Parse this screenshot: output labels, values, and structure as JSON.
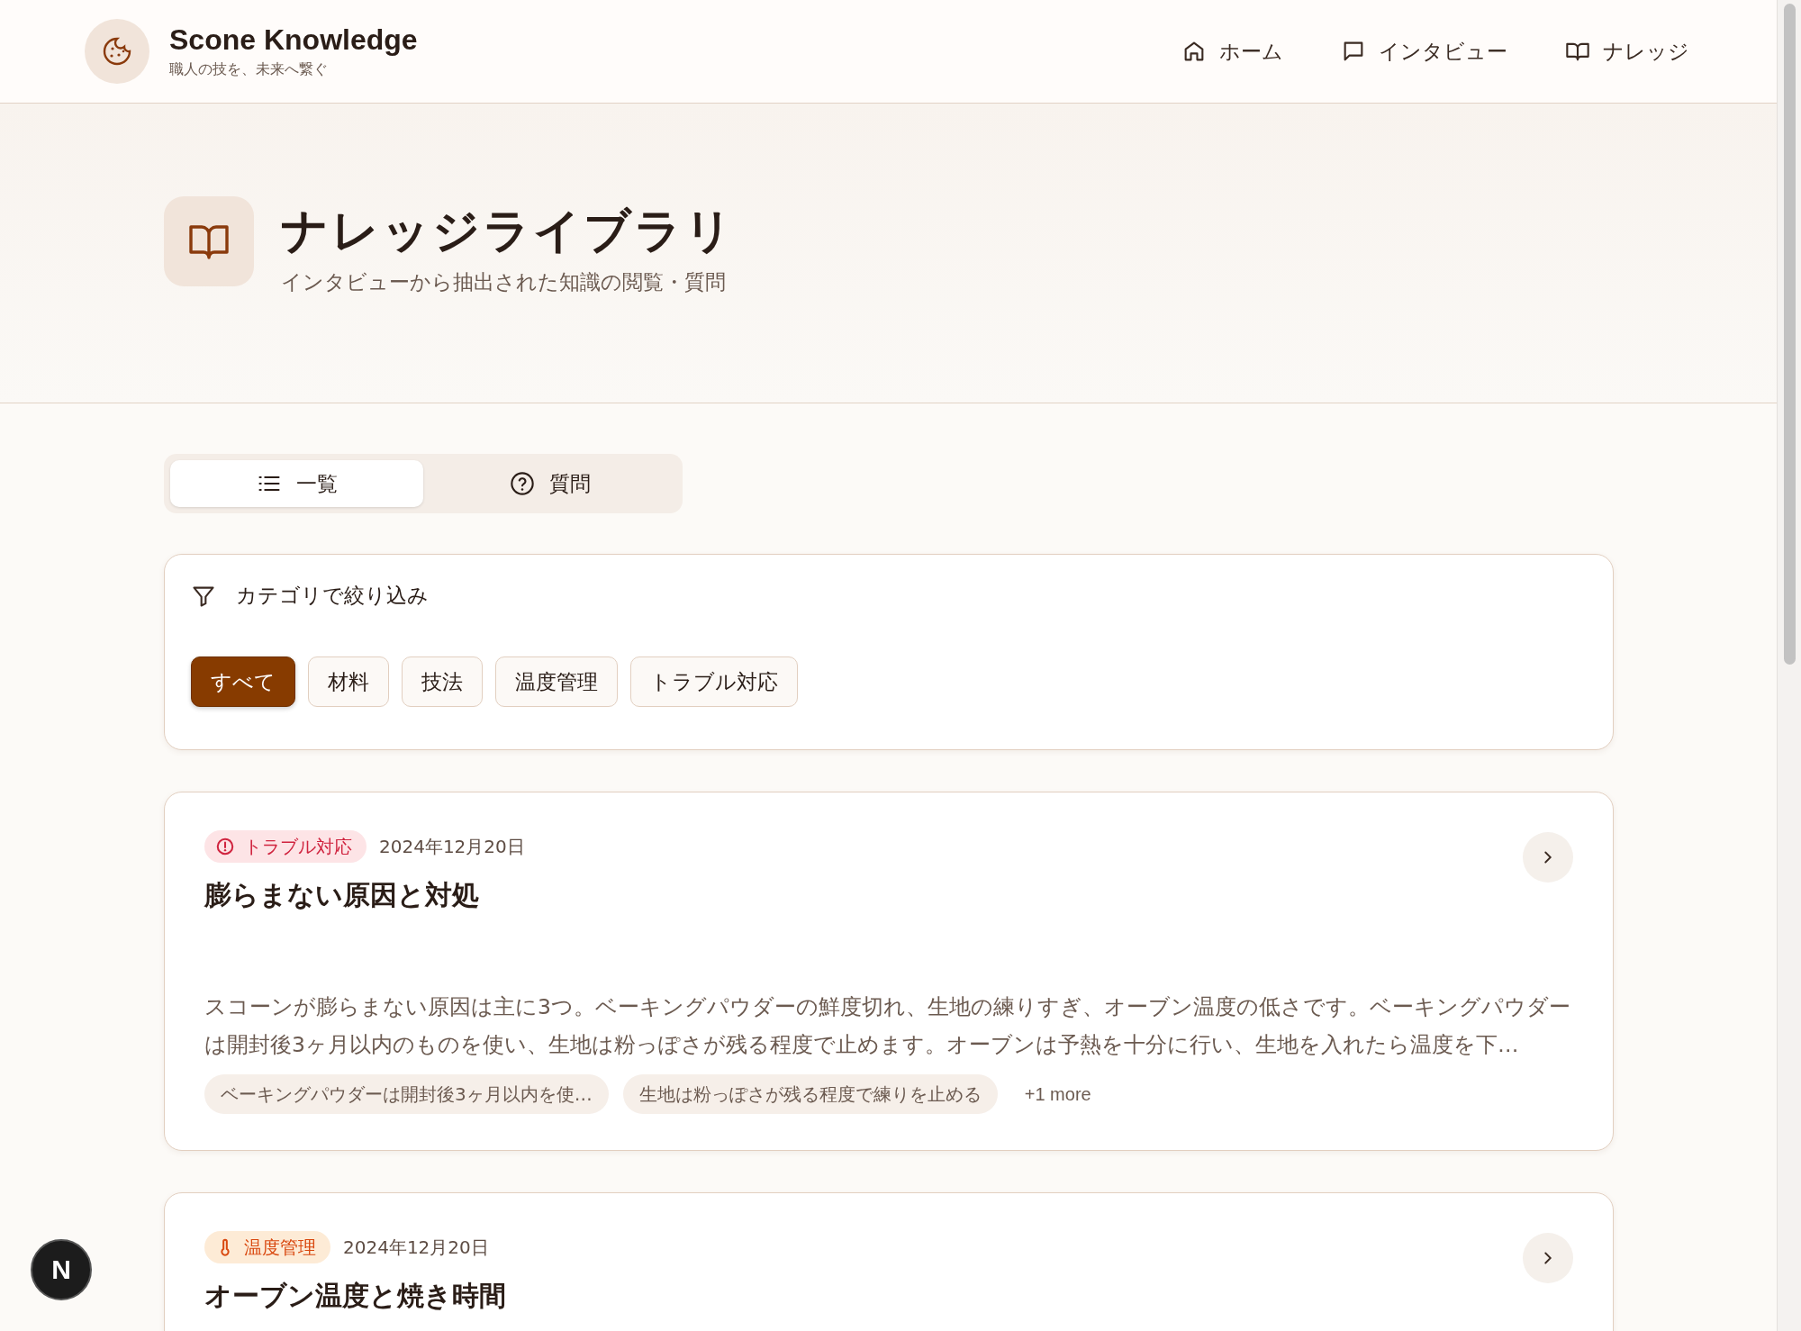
{
  "header": {
    "brand": "Scone Knowledge",
    "tagline": "職人の技を、未来へ繋ぐ",
    "nav": [
      {
        "label": "ホーム",
        "kind": "home"
      },
      {
        "label": "インタビュー",
        "kind": "chat"
      },
      {
        "label": "ナレッジ",
        "kind": "book"
      }
    ]
  },
  "hero": {
    "title": "ナレッジライブラリ",
    "subtitle": "インタビューから抽出された知識の閲覧・質問"
  },
  "tabs": [
    {
      "label": "一覧",
      "kind": "list",
      "selected": true
    },
    {
      "label": "質問",
      "kind": "question",
      "selected": false
    }
  ],
  "filter": {
    "label": "カテゴリで絞り込み",
    "chips": [
      {
        "label": "すべて",
        "selected": true
      },
      {
        "label": "材料",
        "selected": false
      },
      {
        "label": "技法",
        "selected": false
      },
      {
        "label": "温度管理",
        "selected": false
      },
      {
        "label": "トラブル対応",
        "selected": false
      }
    ]
  },
  "cards": [
    {
      "tag": "トラブル対応",
      "kind": "alert",
      "color": "#d0243f",
      "date": "2024年12月20日",
      "title": "膨らまない原因と対処",
      "body": "スコーンが膨らまない原因は主に3つ。ベーキングパウダーの鮮度切れ、生地の練りすぎ、オーブン温度の低さです。ベーキングパウダーは開封後3ヶ月以内のものを使い、生地は粉っぽさが残る程度で止めます。オーブンは予熱を十分に行い、生地を入れたら温度を下…",
      "points": [
        "ベーキングパウダーは開封後3ヶ月以内を使…",
        "生地は粉っぽさが残る程度で練りを止める"
      ],
      "more": "+1 more"
    },
    {
      "tag": "温度管理",
      "kind": "thermometer",
      "color": "#d9480f",
      "date": "2024年12月20日",
      "title": "オーブン温度と焼き時間"
    }
  ],
  "dev_badge": "N"
}
